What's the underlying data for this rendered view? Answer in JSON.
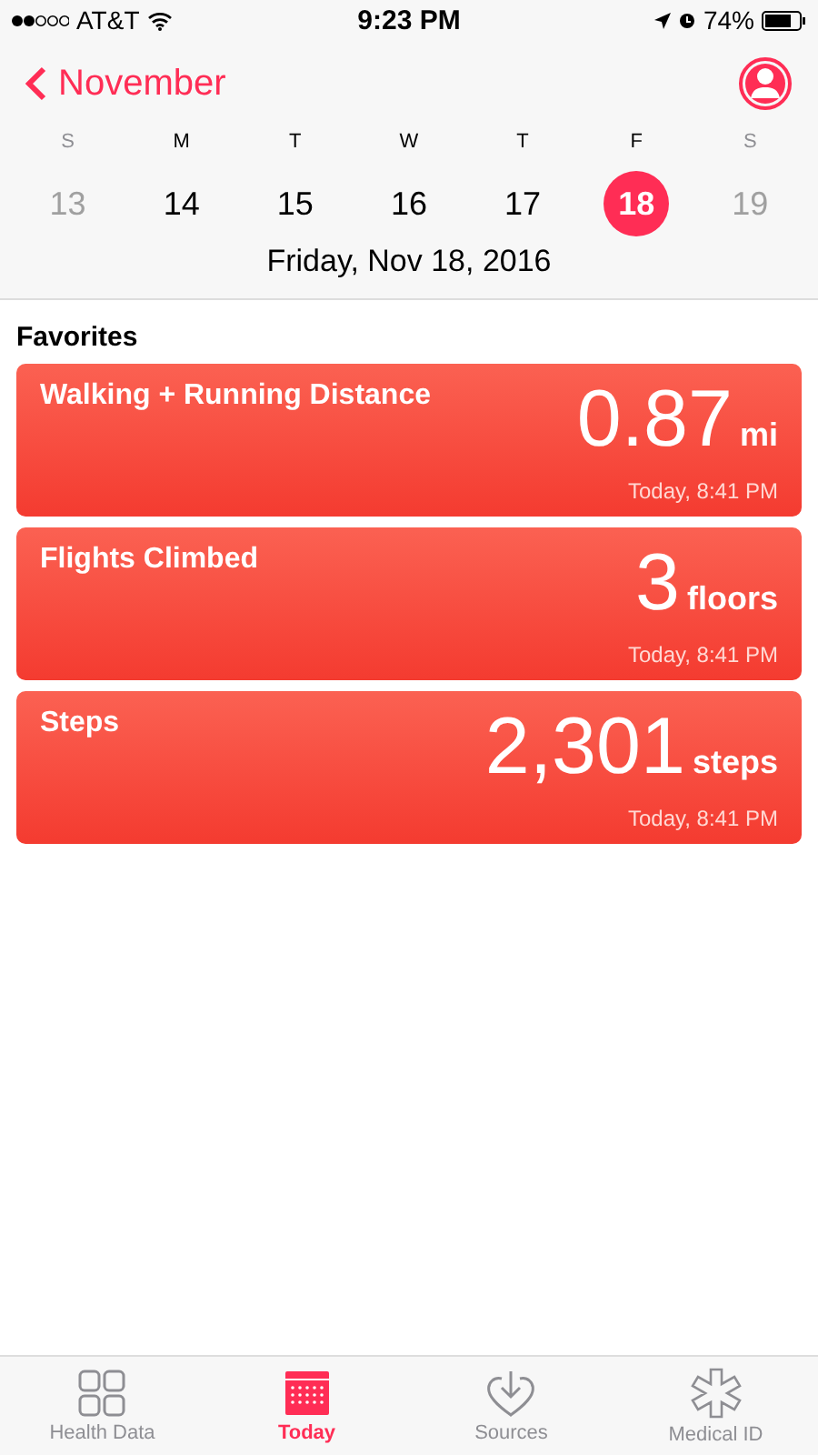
{
  "status_bar": {
    "carrier": "AT&T",
    "time": "9:23 PM",
    "battery": "74%"
  },
  "nav": {
    "back": "November"
  },
  "week": [
    {
      "weekday": "S",
      "date": "13",
      "muted": true,
      "selected": false
    },
    {
      "weekday": "M",
      "date": "14",
      "muted": false,
      "selected": false
    },
    {
      "weekday": "T",
      "date": "15",
      "muted": false,
      "selected": false
    },
    {
      "weekday": "W",
      "date": "16",
      "muted": false,
      "selected": false
    },
    {
      "weekday": "T",
      "date": "17",
      "muted": false,
      "selected": false
    },
    {
      "weekday": "F",
      "date": "18",
      "muted": false,
      "selected": true
    },
    {
      "weekday": "S",
      "date": "19",
      "muted": true,
      "selected": false
    }
  ],
  "date_title": "Friday, Nov 18, 2016",
  "section": "Favorites",
  "favorites": [
    {
      "title": "Walking + Running Distance",
      "value": "0.87",
      "unit": "mi",
      "time": "Today, 8:41 PM"
    },
    {
      "title": "Flights Climbed",
      "value": "3",
      "unit": "floors",
      "time": "Today, 8:41 PM"
    },
    {
      "title": "Steps",
      "value": "2,301",
      "unit": "steps",
      "time": "Today, 8:41 PM"
    }
  ],
  "tabs": [
    {
      "label": "Health Data",
      "kind": "grid",
      "selected": false
    },
    {
      "label": "Today",
      "kind": "calendar",
      "selected": true
    },
    {
      "label": "Sources",
      "kind": "heart",
      "selected": false
    },
    {
      "label": "Medical ID",
      "kind": "asterisk",
      "selected": false
    }
  ]
}
